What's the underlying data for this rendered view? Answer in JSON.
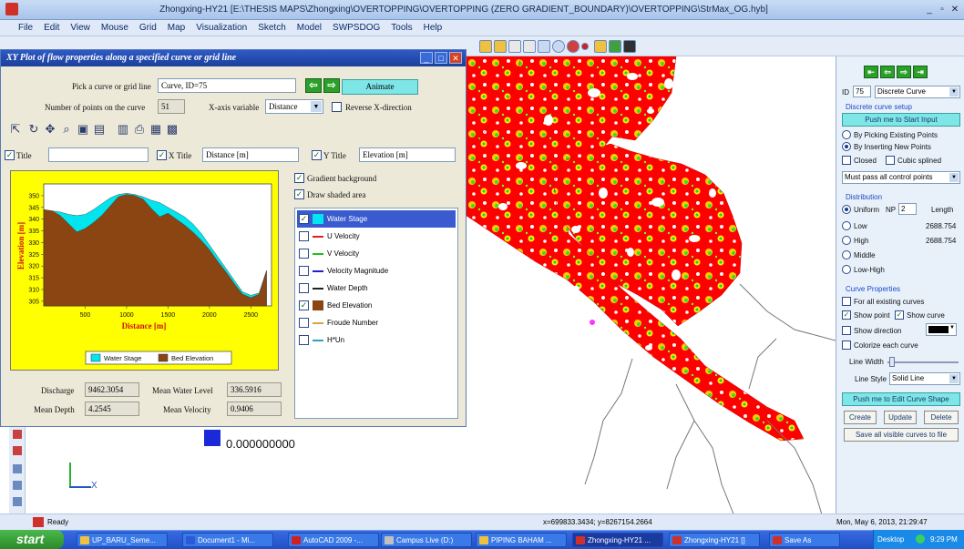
{
  "window": {
    "title": "Zhongxing-HY21 [E:\\THESIS MAPS\\Zhongxing\\OVERTOPPING\\OVERTOPPING (ZERO GRADIENT_BOUNDARY)\\OVERTOPPING\\StrMax_OG.hyb]",
    "controls": [
      "_",
      "▫",
      "✕"
    ]
  },
  "menu": [
    "File",
    "Edit",
    "View",
    "Mouse",
    "Grid",
    "Map",
    "Visualization",
    "Sketch",
    "Model",
    "SWPSDOG",
    "Tools",
    "Help"
  ],
  "dialog": {
    "title": "XY Plot of flow properties along a specified curve or grid line",
    "pick_label": "Pick a curve or grid line",
    "pick_value": "Curve, ID=75",
    "points_label": "Number of points on the curve",
    "points_value": "51",
    "xvar_label": "X-axis variable",
    "xvar_value": "Distance",
    "reverse_label": "Reverse X-direction",
    "animate_label": "Animate",
    "title_chk_label": "Title",
    "title_value": "",
    "xtitle_label": "X Title",
    "xtitle_value": "Distance [m]",
    "ytitle_label": "Y Title",
    "ytitle_value": "Elevation [m]",
    "gradient_label": "Gradient background",
    "shaded_label": "Draw shaded area",
    "series": [
      {
        "name": "Water Stage",
        "checked": true,
        "color": "#00e5ee",
        "kind": "area"
      },
      {
        "name": "U Velocity",
        "checked": false,
        "color": "#e02020",
        "kind": "line"
      },
      {
        "name": "V Velocity",
        "checked": false,
        "color": "#20c020",
        "kind": "line"
      },
      {
        "name": "Velocity Magnitude",
        "checked": false,
        "color": "#2020d0",
        "kind": "line"
      },
      {
        "name": "Water Depth",
        "checked": false,
        "color": "#202020",
        "kind": "line"
      },
      {
        "name": "Bed Elevation",
        "checked": true,
        "color": "#8b4513",
        "kind": "area"
      },
      {
        "name": "Froude Number",
        "checked": false,
        "color": "#e0a040",
        "kind": "line"
      },
      {
        "name": "H*Un",
        "checked": false,
        "color": "#30a0c0",
        "kind": "line"
      }
    ],
    "discharge_label": "Discharge",
    "discharge_value": "9462.3054",
    "mean_level_label": "Mean Water Level",
    "mean_level_value": "336.5916",
    "mean_depth_label": "Mean Depth",
    "mean_depth_value": "4.2545",
    "mean_vel_label": "Mean Velocity",
    "mean_vel_value": "0.9406"
  },
  "chart_data": {
    "type": "area",
    "xlabel": "Distance [m]",
    "ylabel": "Elevation [m]",
    "xlim": [
      0,
      2750
    ],
    "ylim": [
      303,
      355
    ],
    "xticks": [
      500,
      1000,
      1500,
      2000,
      2500
    ],
    "yticks": [
      305,
      310,
      315,
      320,
      325,
      330,
      335,
      340,
      345,
      350
    ],
    "legend": [
      "Water Stage",
      "Bed Elevation"
    ],
    "legend_position": "bottom",
    "x": [
      0,
      100,
      200,
      300,
      400,
      500,
      600,
      700,
      800,
      900,
      1000,
      1100,
      1200,
      1300,
      1400,
      1500,
      1600,
      1700,
      1800,
      1900,
      2000,
      2100,
      2200,
      2300,
      2400,
      2500,
      2600,
      2690
    ],
    "series": [
      {
        "name": "Water Stage",
        "color": "#00e5ee",
        "values": [
          344,
          343.5,
          343,
          342,
          341.5,
          342,
          344,
          346.5,
          349,
          350.5,
          351,
          350.5,
          349.5,
          348,
          347,
          345,
          343,
          341,
          338,
          334,
          329,
          324,
          319,
          314,
          309,
          307.5,
          308.5,
          318
        ]
      },
      {
        "name": "Bed Elevation",
        "color": "#8b4513",
        "values": [
          344,
          343.5,
          341.5,
          338,
          334.5,
          336,
          338.5,
          341.5,
          345.5,
          349.5,
          350.5,
          350,
          348.5,
          344.5,
          341,
          342.5,
          340,
          337.5,
          334.5,
          331,
          327,
          322,
          317.5,
          312.5,
          308,
          306.5,
          308,
          318
        ]
      }
    ]
  },
  "map": {
    "legend_value": "0.000000000",
    "axis_label": "X"
  },
  "panel": {
    "id_label": "ID",
    "id_value": "75",
    "curve_type": "Discrete Curve",
    "setup_label": "Discrete curve setup",
    "start_input": "Push me to Start Input",
    "opt_picking": "By Picking Existing Points",
    "opt_inserting": "By Inserting New Points",
    "closed_label": "Closed",
    "cubic_label": "Cubic splined",
    "pass_mode": "Must pass all control points",
    "distribution_label": "Distribution",
    "uniform_label": "Uniform",
    "np_label": "NP",
    "np_value": "2",
    "length_label": "Length",
    "low_label": "Low",
    "low_value": "2688.754",
    "high_label": "High",
    "high_value": "2688.754",
    "middle_label": "Middle",
    "lowhigh_label": "Low-High",
    "props_label": "Curve Properties",
    "for_all_label": "For all existing curves",
    "show_point_label": "Show point",
    "show_curve_label": "Show curve",
    "show_dir_label": "Show direction",
    "colorize_label": "Colorize each curve",
    "line_width_label": "Line Width",
    "line_style_label": "Line Style",
    "line_style_value": "Solid Line",
    "edit_shape": "Push me to Edit Curve Shape",
    "create_label": "Create",
    "update_label": "Update",
    "delete_label": "Delete",
    "save_all": "Save all visible curves to file"
  },
  "status": {
    "ready": "Ready",
    "coords": "x=699833.3434; y=8267154.2664",
    "datetime": "Mon, May 6, 2013, 21:29:47"
  },
  "taskbar": {
    "start": "start",
    "tasks": [
      "UP_BARU_Seme...",
      "Document1 - Mi...",
      "AutoCAD 2009 -...",
      "Campus Live (D:)",
      "PIPING BAHAM ...",
      "Zhongxing-HY21 ...",
      "Zhongxing-HY21 []",
      "Save As"
    ],
    "tray_label": "Desktop",
    "clock": "9:29 PM"
  }
}
